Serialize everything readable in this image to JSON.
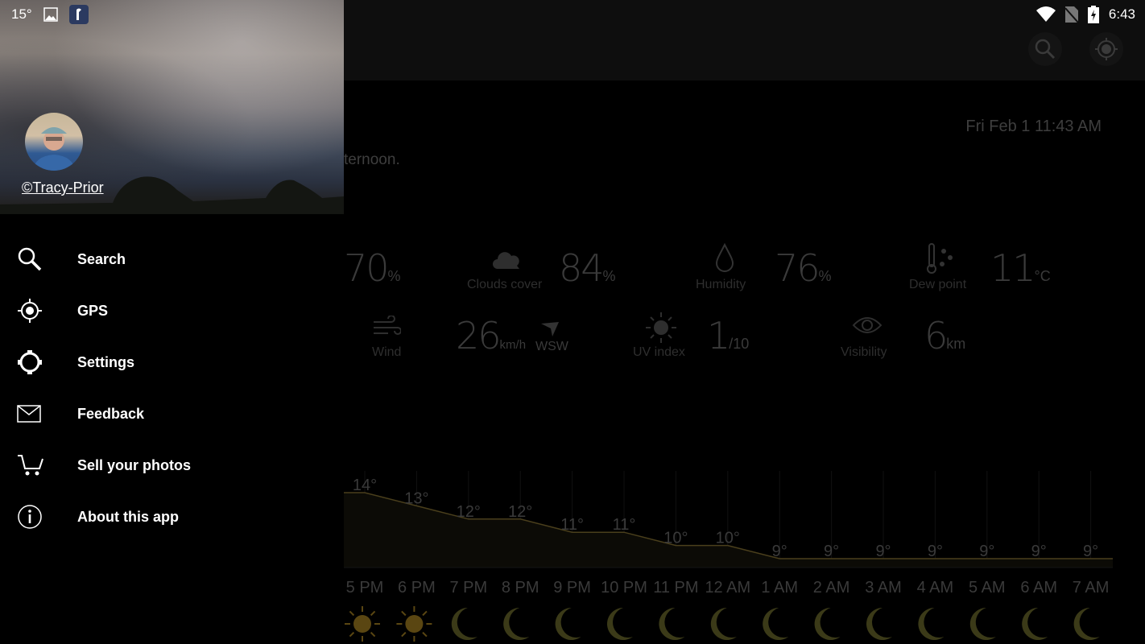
{
  "status_bar": {
    "temperature": "15°",
    "time": "6:43"
  },
  "main": {
    "date": "Fri Feb 1 11:43 AM",
    "summary_partial": "ternoon.",
    "stats": [
      {
        "label": "",
        "value": "70",
        "unit": "%"
      },
      {
        "label": "Clouds cover",
        "value": "84",
        "unit": "%",
        "icon": "cloud-icon"
      },
      {
        "label": "Humidity",
        "value": "76",
        "unit": "%",
        "icon": "drop-icon"
      },
      {
        "label": "Dew point",
        "value": "11",
        "unit": "°C",
        "icon": "thermometer-icon"
      },
      {
        "label": "Wind",
        "value": "26",
        "unit": "km/h",
        "direction": "WSW",
        "icon": "wind-icon"
      },
      {
        "label": "UV index",
        "value": "1",
        "unit": "/10",
        "icon": "sun-icon"
      },
      {
        "label": "Visibility",
        "value": "6",
        "unit": "km",
        "icon": "eye-icon"
      }
    ]
  },
  "chart_data": {
    "type": "area",
    "categories": [
      "5 PM",
      "6 PM",
      "7 PM",
      "8 PM",
      "9 PM",
      "10 PM",
      "11 PM",
      "12 AM",
      "1 AM",
      "2 AM",
      "3 AM",
      "4 AM",
      "5 AM",
      "6 AM",
      "7 AM"
    ],
    "values": [
      14,
      13,
      12,
      12,
      11,
      11,
      10,
      10,
      9,
      9,
      9,
      9,
      9,
      9,
      9
    ],
    "value_labels": [
      "14°",
      "13°",
      "12°",
      "12°",
      "11°",
      "11°",
      "10°",
      "10°",
      "9°",
      "9°",
      "9°",
      "9°",
      "9°",
      "9°",
      "9°"
    ],
    "conditions": [
      "sun",
      "sun",
      "moon",
      "moon",
      "moon",
      "moon",
      "moon",
      "moon",
      "moon",
      "moon",
      "moon",
      "moon",
      "moon",
      "moon",
      "moon"
    ],
    "line_color": "#4a3f1c",
    "sun_color": "#5a4612",
    "moon_color": "#3b3a18"
  },
  "drawer": {
    "photo_credit": "©Tracy-Prior",
    "items": [
      {
        "label": "Search",
        "icon": "search-icon"
      },
      {
        "label": "GPS",
        "icon": "gps-icon"
      },
      {
        "label": "Settings",
        "icon": "settings-icon"
      },
      {
        "label": "Feedback",
        "icon": "mail-icon"
      },
      {
        "label": "Sell your photos",
        "icon": "cart-icon"
      },
      {
        "label": "About this app",
        "icon": "info-icon"
      }
    ]
  }
}
